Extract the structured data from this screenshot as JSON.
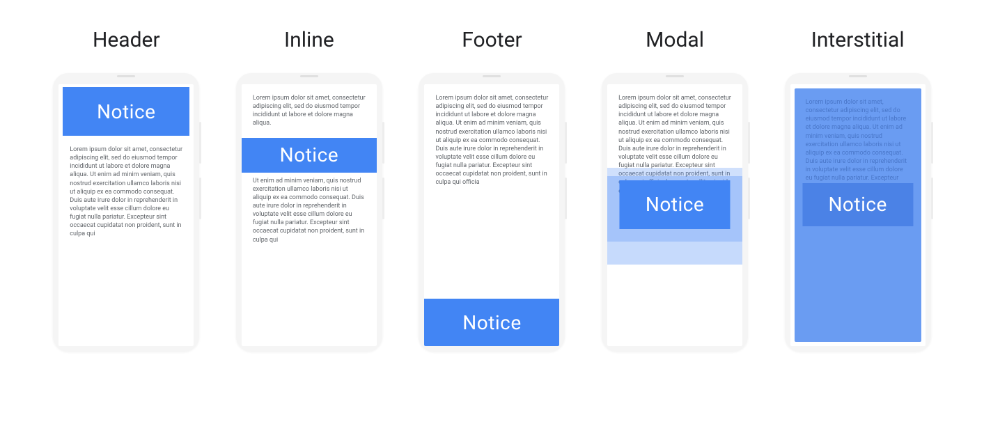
{
  "notice_label": "Notice",
  "variants": [
    {
      "id": "header",
      "title": "Header"
    },
    {
      "id": "inline",
      "title": "Inline"
    },
    {
      "id": "footer",
      "title": "Footer"
    },
    {
      "id": "modal",
      "title": "Modal"
    },
    {
      "id": "interstitial",
      "title": "Interstitial"
    }
  ],
  "lorem_short": "Lorem ipsum dolor sit amet, consectetur adipiscing elit, sed do eiusmod tempor incididunt ut labore et dolore magna aliqua.",
  "lorem_long": "Lorem ipsum dolor sit amet, consectetur adipiscing elit, sed do eiusmod tempor incididunt ut labore et dolore magna aliqua. Ut enim ad minim veniam, quis nostrud exercitation ullamco laboris nisi ut aliquip ex ea commodo consequat. Duis aute irure dolor in reprehenderit in voluptate velit esse cillum dolore eu fugiat nulla pariatur. Excepteur sint occaecat cupidatat non proident, sunt in culpa qui",
  "lorem_block2": "Ut enim ad minim veniam, quis nostrud exercitation ullamco laboris nisi ut aliquip ex ea commodo consequat. Duis aute irure dolor in reprehenderit in voluptate velit esse cillum dolore eu fugiat nulla pariatur. Excepteur sint occaecat cupidatat non proident, sunt in culpa qui",
  "lorem_footer": "Lorem ipsum dolor sit amet, consectetur adipiscing elit, sed do eiusmod tempor incididunt ut labore et dolore magna aliqua. Ut enim ad minim veniam, quis nostrud exercitation ullamco laboris nisi ut aliquip ex ea commodo consequat. Duis aute irure dolor in reprehenderit in voluptate velit esse cillum dolore eu fugiat nulla pariatur. Excepteur sint occaecat cupidatat non proident, sunt in culpa qui officia",
  "lorem_modal": "Lorem ipsum dolor sit amet, consectetur adipiscing elit, sed do eiusmod tempor incididunt ut labore et dolore magna aliqua. Ut enim ad minim veniam, quis nostrud exercitation ullamco laboris nisi ut aliquip ex ea commodo consequat. Duis aute irure dolor in reprehenderit in voluptate velit esse cillum dolore eu fugiat nulla pariatur. Excepteur sint occaecat cupidatat non proident, sunt in culpa qui officia deserunt mollit anim id est laborum.",
  "lorem_interstitial": "Lorem ipsum dolor sit amet, consectetur adipiscing elit, sed do eiusmod tempor incididunt ut labore et dolore magna aliqua. Ut enim ad minim veniam, quis nostrud exercitation ullamco laboris nisi ut aliquip ex ea commodo consequat. Duis aute irure dolor in reprehenderit in voluptate velit esse cillum dolore eu fugiat nulla pariatur. Excepteur sint occaecat cupidatat non proident, sunt in culpa qui officia deserunt mollit anim id est laborum.",
  "colors": {
    "notice_bg": "#4285f4",
    "notice_text": "#ffffff",
    "body_text": "#5f6368",
    "phone_frame": "#f5f5f5",
    "interstitial_bg": "#6a9cf2"
  }
}
